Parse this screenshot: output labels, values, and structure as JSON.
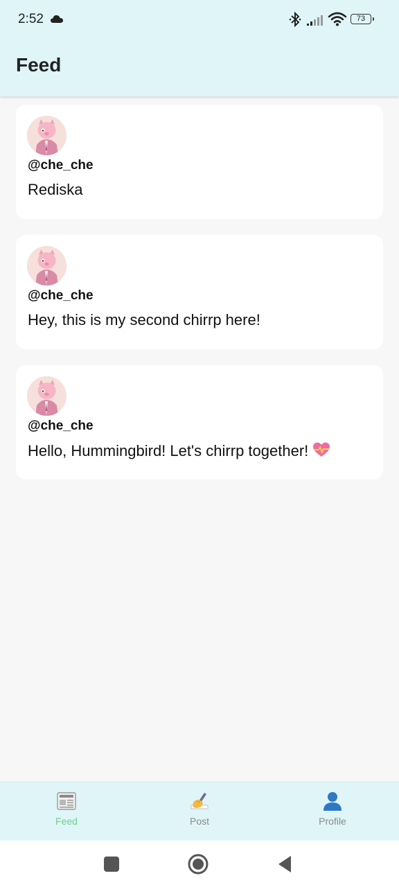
{
  "status_bar": {
    "time": "2:52",
    "battery": "73",
    "icons": [
      "cloud-icon",
      "bluetooth-icon",
      "signal-icon",
      "wifi-icon",
      "battery-icon"
    ]
  },
  "header": {
    "title": "Feed"
  },
  "posts": [
    {
      "handle": "@che_che",
      "text": "Rediska"
    },
    {
      "handle": "@che_che",
      "text": "Hey, this is my second chirrp here!"
    },
    {
      "handle": "@che_che",
      "text": "Hello, Hummingbird! Let's chirrp together!",
      "emoji": "heart-icon"
    }
  ],
  "tabs": [
    {
      "label": "Feed",
      "icon": "newspaper-icon",
      "active": true
    },
    {
      "label": "Post",
      "icon": "writing-hand-icon",
      "active": false
    },
    {
      "label": "Profile",
      "icon": "user-icon",
      "active": false
    }
  ],
  "colors": {
    "header_bg": "#dff5f8",
    "page_bg": "#f7f7f7",
    "card_bg": "#ffffff",
    "active_tab": "#6dd08a",
    "inactive_tab": "#8a8a8a"
  }
}
